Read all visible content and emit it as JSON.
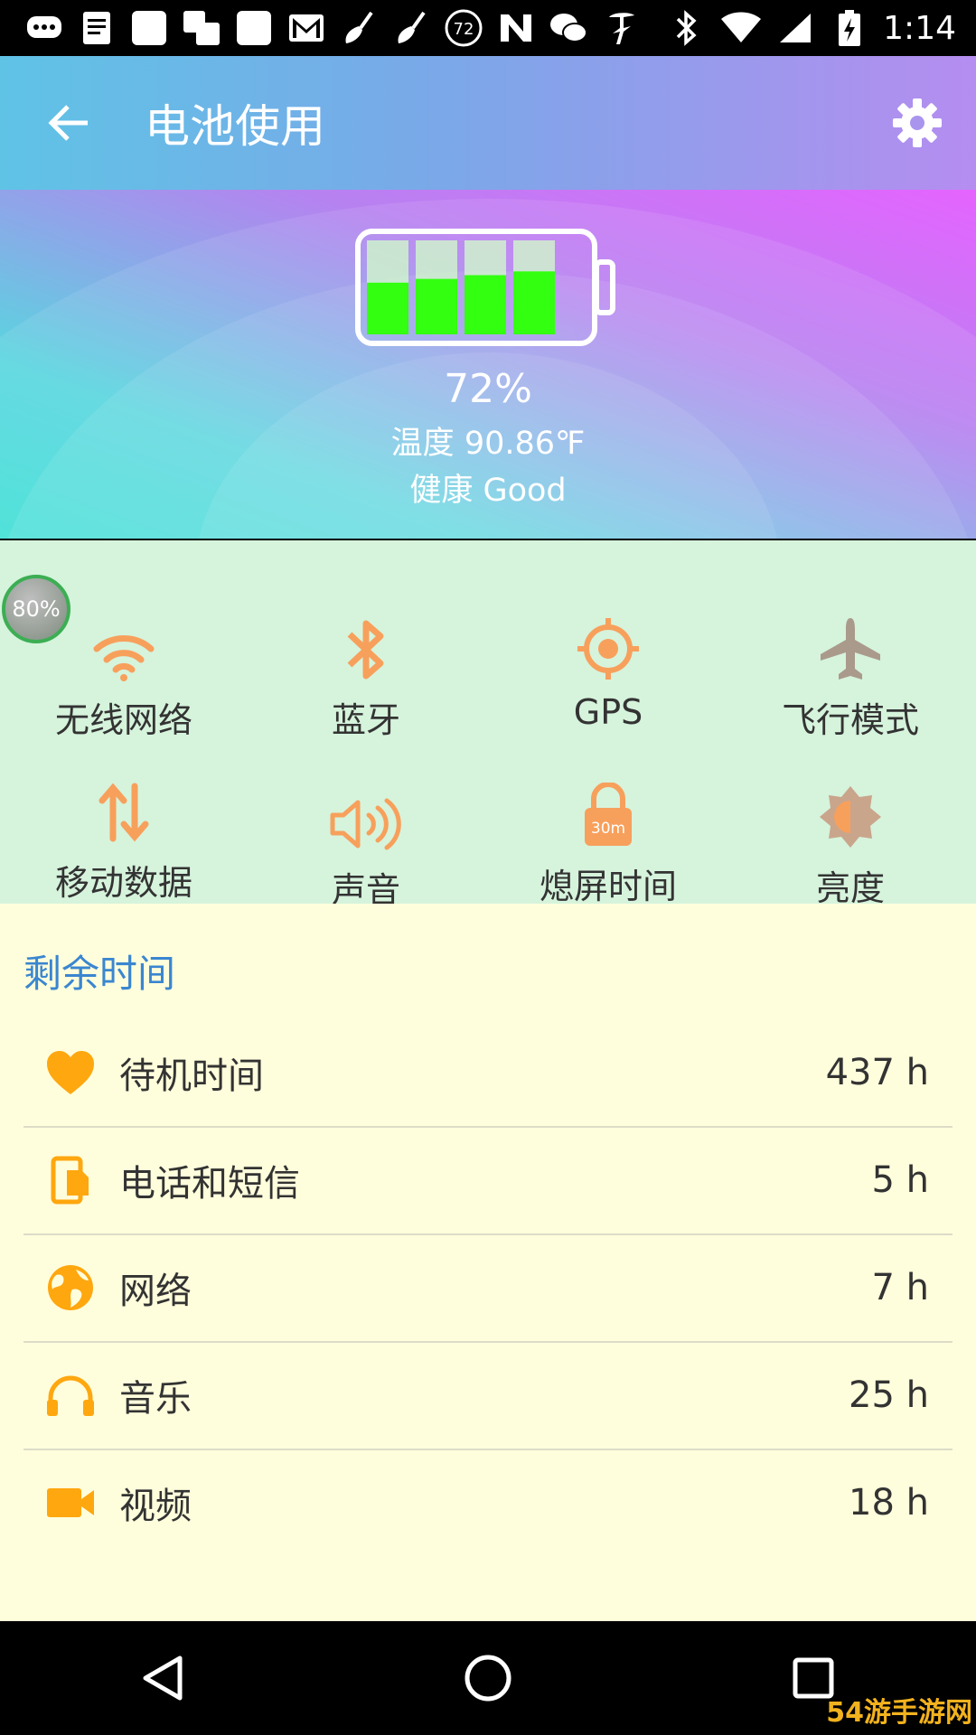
{
  "status_bar": {
    "time": "1:14",
    "notification_badge": "72"
  },
  "toolbar": {
    "title": "电池使用"
  },
  "battery": {
    "percent": "72%",
    "level": 0.72,
    "temperature_label": "温度",
    "temperature_value": "90.86℉",
    "health_label": "健康",
    "health_value": "Good",
    "fill_color": "#33ff11"
  },
  "floating_badge": "80%",
  "toggles": [
    {
      "label": "无线网络",
      "icon": "wifi-icon"
    },
    {
      "label": "蓝牙",
      "icon": "bluetooth-icon"
    },
    {
      "label": "GPS",
      "icon": "gps-icon"
    },
    {
      "label": "飞行模式",
      "icon": "airplane-icon"
    },
    {
      "label": "移动数据",
      "icon": "mobile-data-icon"
    },
    {
      "label": "声音",
      "icon": "sound-icon"
    },
    {
      "label": "熄屏时间",
      "icon": "screen-timeout-icon",
      "badge": "30m"
    },
    {
      "label": "亮度",
      "icon": "brightness-icon"
    }
  ],
  "remaining": {
    "title": "剩余时间",
    "items": [
      {
        "label": "待机时间",
        "value": "437 h",
        "icon": "heart-icon"
      },
      {
        "label": "电话和短信",
        "value": "5 h",
        "icon": "phone-icon"
      },
      {
        "label": "网络",
        "value": "7 h",
        "icon": "globe-icon"
      },
      {
        "label": "音乐",
        "value": "25 h",
        "icon": "headphones-icon"
      },
      {
        "label": "视频",
        "value": "18 h",
        "icon": "video-icon"
      }
    ]
  },
  "colors": {
    "accent_orange": "#f7a05c",
    "list_icon_orange": "#ffa70f",
    "section_title_blue": "#3a86d0",
    "toggle_bg": "#d6f3dc",
    "list_bg": "#fffedc"
  },
  "watermark": "54游手游网"
}
